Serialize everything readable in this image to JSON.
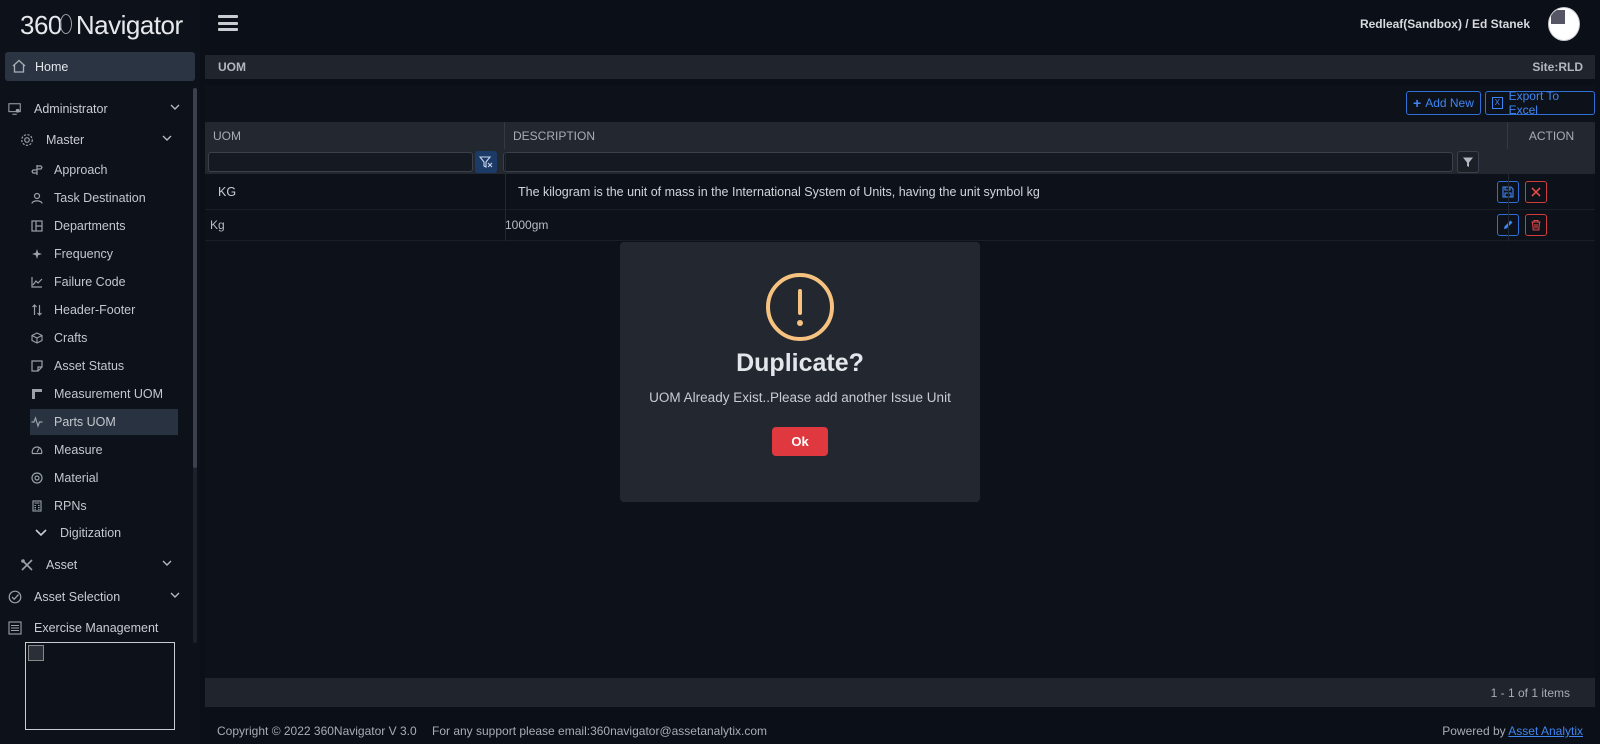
{
  "app": {
    "logo_number": "360",
    "logo_text": "Navigator",
    "user_label": "Redleaf(Sandbox) / Ed Stanek"
  },
  "sidebar": {
    "home": "Home",
    "groups": [
      {
        "label": "Administrator",
        "icon": "monitor-user-icon"
      },
      {
        "label": "Master",
        "icon": "gear-icon"
      }
    ],
    "master_items": [
      {
        "label": "Approach",
        "icon": "signpost-icon"
      },
      {
        "label": "Task Destination",
        "icon": "user-icon"
      },
      {
        "label": "Departments",
        "icon": "layout-icon"
      },
      {
        "label": "Frequency",
        "icon": "sparkle-icon"
      },
      {
        "label": "Failure Code",
        "icon": "line-chart-icon"
      },
      {
        "label": "Header-Footer",
        "icon": "sort-arrows-icon"
      },
      {
        "label": "Crafts",
        "icon": "box-icon"
      },
      {
        "label": "Asset Status",
        "icon": "note-icon"
      },
      {
        "label": "Measurement UOM",
        "icon": "ruler-icon"
      },
      {
        "label": "Parts UOM",
        "icon": "pulse-icon"
      },
      {
        "label": "Measure",
        "icon": "gauge-icon"
      },
      {
        "label": "Material",
        "icon": "target-icon"
      },
      {
        "label": "RPNs",
        "icon": "calculator-icon"
      },
      {
        "label": "Digitization",
        "icon": "chevron-down-icon"
      }
    ],
    "bottom_groups": [
      {
        "label": "Asset",
        "icon": "tools-icon"
      },
      {
        "label": "Asset Selection",
        "icon": "check-circle-icon"
      },
      {
        "label": "Exercise Management",
        "icon": "list-icon"
      }
    ]
  },
  "breadcrumb": {
    "page": "UOM",
    "site": "Site:RLD"
  },
  "toolbar": {
    "add_new": "Add New",
    "export": "Export To Excel"
  },
  "grid": {
    "columns": [
      "UOM",
      "DESCRIPTION",
      "ACTION"
    ],
    "edit_row": {
      "uom": "KG",
      "description": "The kilogram is the unit of mass in the International System of Units, having the unit symbol kg"
    },
    "rows": [
      {
        "uom": "Kg",
        "description": "1000gm"
      }
    ],
    "pager": "1 - 1 of 1 items"
  },
  "footer": {
    "copyright": "Copyright © 2022 360Navigator V 3.0",
    "support": "For any support please email:360navigator@assetanalytix.com",
    "powered_by": "Powered by",
    "powered_link": "Asset Analytix"
  },
  "modal": {
    "title": "Duplicate?",
    "message": "UOM Already Exist..Please add another Issue Unit",
    "ok": "Ok"
  }
}
